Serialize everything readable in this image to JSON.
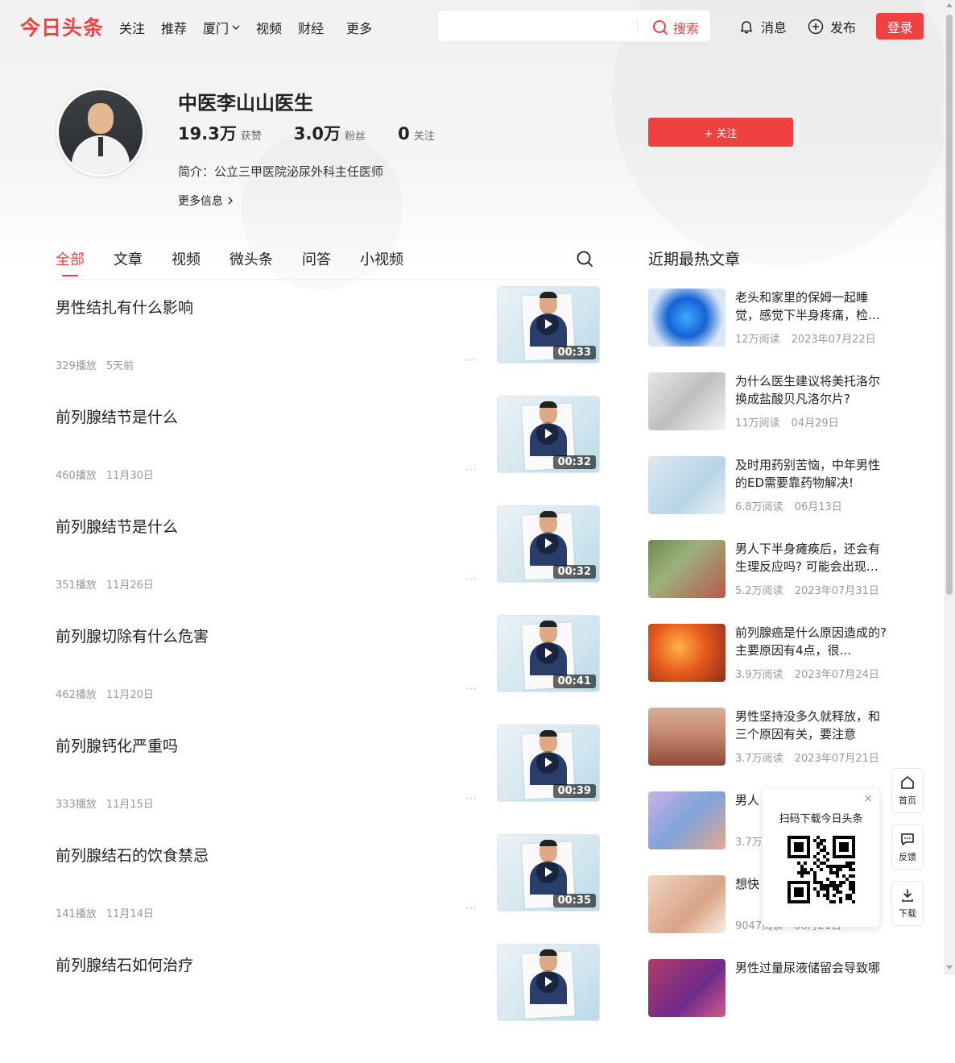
{
  "header": {
    "logo": "今日头条",
    "nav": [
      "关注",
      "推荐",
      "厦门",
      "视频",
      "财经"
    ],
    "nav_more": "更多",
    "search_placeholder": "",
    "search_button": "搜索",
    "messages": "消息",
    "publish": "发布",
    "login": "登录"
  },
  "profile": {
    "name": "中医李山山医生",
    "likes_num": "19.3万",
    "likes_label": "获赞",
    "fans_num": "3.0万",
    "fans_label": "粉丝",
    "following_num": "0",
    "following_label": "关注",
    "bio": "简介：公立三甲医院泌尿外科主任医师",
    "more_info": "更多信息",
    "follow_button": "+ 关注"
  },
  "tabs": [
    "全部",
    "文章",
    "视频",
    "微头条",
    "问答",
    "小视频"
  ],
  "feed": [
    {
      "title": "男性结扎有什么影响",
      "plays": "329播放",
      "time": "5天前",
      "duration": "00:33"
    },
    {
      "title": "前列腺结节是什么",
      "plays": "460播放",
      "time": "11月30日",
      "duration": "00:32"
    },
    {
      "title": "前列腺结节是什么",
      "plays": "351播放",
      "time": "11月26日",
      "duration": "00:32"
    },
    {
      "title": "前列腺切除有什么危害",
      "plays": "462播放",
      "time": "11月20日",
      "duration": "00:41"
    },
    {
      "title": "前列腺钙化严重吗",
      "plays": "333播放",
      "time": "11月15日",
      "duration": "00:39"
    },
    {
      "title": "前列腺结石的饮食禁忌",
      "plays": "141播放",
      "time": "11月14日",
      "duration": "00:35"
    },
    {
      "title": "前列腺结石如何治疗",
      "plays": "",
      "time": "",
      "duration": ""
    }
  ],
  "sidebar": {
    "title": "近期最热文章",
    "items": [
      {
        "title": "老头和家里的保姆一起睡觉，感觉下半身疼痛，检…",
        "reads": "12万阅读",
        "date": "2023年07月22日"
      },
      {
        "title": "为什么医生建议将美托洛尔换成盐酸贝凡洛尔片?",
        "reads": "11万阅读",
        "date": "04月29日"
      },
      {
        "title": "及时用药别苦恼，中年男性的ED需要靠药物解决!",
        "reads": "6.8万阅读",
        "date": "06月13日"
      },
      {
        "title": "男人下半身瘫痪后，还会有生理反应吗? 可能会出现…",
        "reads": "5.2万阅读",
        "date": "2023年07月31日"
      },
      {
        "title": "前列腺癌是什么原因造成的? 主要原因有4点，很…",
        "reads": "3.9万阅读",
        "date": "2023年07月24日"
      },
      {
        "title": "男性坚持没多久就释放，和三个原因有关，要注意",
        "reads": "3.7万阅读",
        "date": "2023年07月21日"
      },
      {
        "title": "男人 生这",
        "reads": "3.7万",
        "date": ""
      },
      {
        "title": "想快 养素",
        "reads": "9047阅读",
        "date": "06月21日"
      },
      {
        "title": "男性过量尿液储留会导致哪",
        "reads": "",
        "date": ""
      }
    ]
  },
  "qr_popup": {
    "text": "扫码下载今日头条",
    "close": "×"
  },
  "float_toolbar": {
    "home": "首页",
    "feedback": "反馈",
    "download": "下载"
  },
  "colors": {
    "brand": "#f04142",
    "text": "#222222",
    "muted": "#999999"
  }
}
